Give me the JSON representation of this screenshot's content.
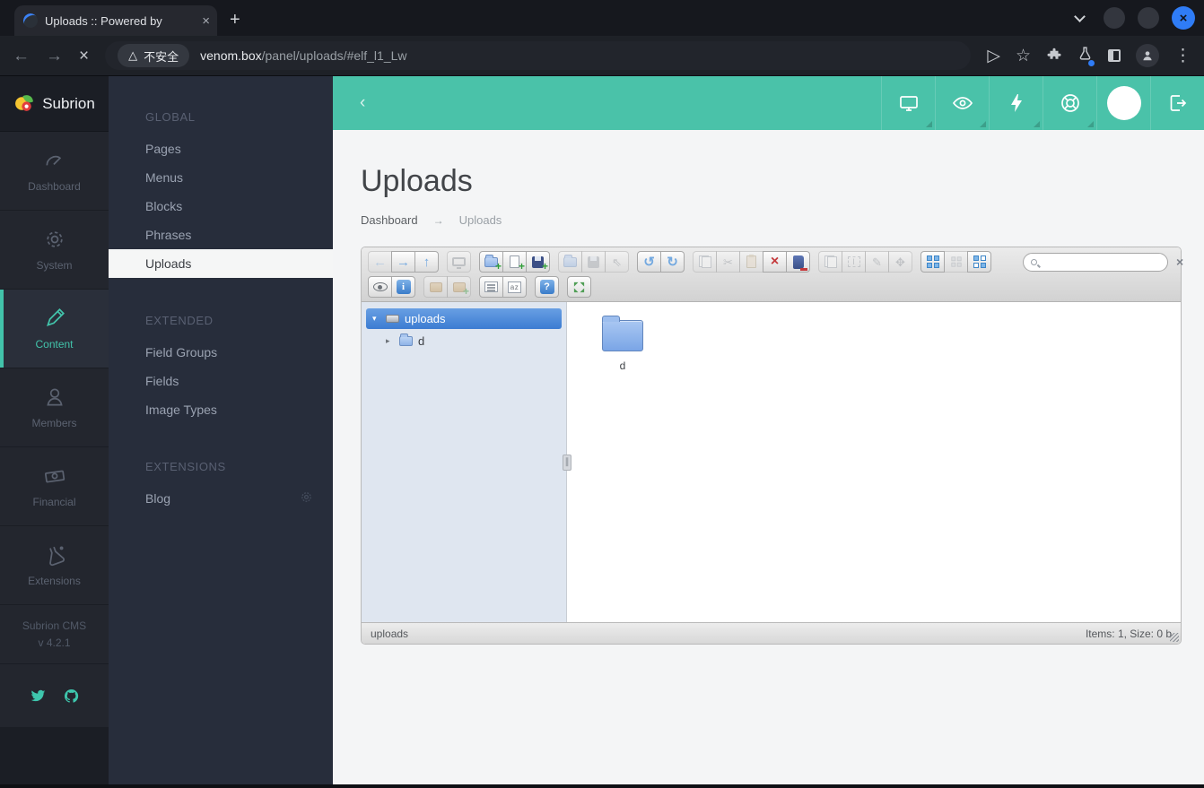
{
  "browser": {
    "tab_title": "Uploads :: Powered by",
    "security_badge": "不安全",
    "url_host": "venom.box",
    "url_rest": "/panel/uploads/#elf_l1_Lw"
  },
  "sidebar": {
    "logo_text": "Subrion",
    "items": [
      {
        "label": "Dashboard"
      },
      {
        "label": "System"
      },
      {
        "label": "Content"
      },
      {
        "label": "Members"
      },
      {
        "label": "Financial"
      },
      {
        "label": "Extensions"
      }
    ],
    "footer_line1": "Subrion CMS",
    "footer_line2": "v 4.2.1"
  },
  "menu": {
    "global_title": "GLOBAL",
    "global_items": [
      "Pages",
      "Menus",
      "Blocks",
      "Phrases",
      "Uploads"
    ],
    "extended_title": "EXTENDED",
    "extended_items": [
      "Field Groups",
      "Fields",
      "Image Types"
    ],
    "extensions_title": "EXTENSIONS",
    "extensions_items": [
      "Blog"
    ]
  },
  "page": {
    "title": "Uploads",
    "breadcrumb_home": "Dashboard",
    "breadcrumb_sep": "→",
    "breadcrumb_current": "Uploads"
  },
  "filemanager": {
    "tree_root": "uploads",
    "tree_child": "d",
    "file_name": "d",
    "status_left": "uploads",
    "status_right": "Items: 1, Size: 0 b",
    "search_placeholder": ""
  },
  "icons": {
    "back": "←",
    "forward": "→",
    "stop": "×",
    "send": "▷",
    "star": "☆",
    "menu_kebab": "⋮",
    "tab_close": "×",
    "new_tab": "+",
    "window_close": "×",
    "warning": "△",
    "collapse_chevron": "‹",
    "tb_back": "←",
    "tb_forward": "→",
    "tb_up": "↑",
    "tb_undo": "↺",
    "tb_redo": "↻",
    "tb_cut": "✂",
    "tb_delete": "×",
    "tb_pointer": "⇖",
    "tb_rename": "I",
    "tb_edit": "✎",
    "tb_resize": "✥",
    "tb_fullscreen": "⤡",
    "tb_sort": "az",
    "tb_info": "i",
    "tb_help": "?",
    "tb_close": "×",
    "caret_open": "▾",
    "caret_closed": "▸",
    "splitter": "∥"
  },
  "colors": {
    "accent_teal": "#4ac2a9",
    "tree_selected": "#3c7cd2",
    "close_button_blue": "#2f7cf6"
  }
}
